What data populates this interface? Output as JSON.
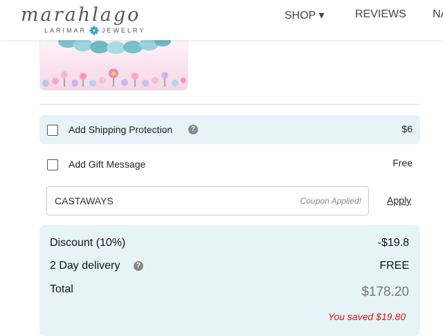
{
  "header": {
    "logo_script": "marahlago",
    "logo_sub_left": "LARIMAR",
    "logo_sub_right": "JEWELRY",
    "nav": {
      "shop": "SHOP ▾",
      "reviews": "REVIEWS",
      "more": "NA"
    }
  },
  "cart": {
    "shipping_protection": {
      "label": "Add Shipping Protection",
      "price": "$6",
      "checked": false
    },
    "gift_message": {
      "label": "Add Gift Message",
      "price": "Free",
      "checked": false
    },
    "coupon": {
      "code": "CASTAWAYS",
      "status": "Coupon Applied!",
      "apply_label": "Apply"
    }
  },
  "summary": {
    "discount_label": "Discount (10%)",
    "discount_value": "-$19.8",
    "delivery_label": "2 Day delivery",
    "delivery_value": "FREE",
    "total_label": "Total",
    "total_value": "$178.20",
    "saved_text": "You saved $19.80"
  },
  "colors": {
    "panel_bg": "#e6f4f7",
    "savings_red": "#e01010",
    "logo_flower": "#2aa0c8"
  }
}
